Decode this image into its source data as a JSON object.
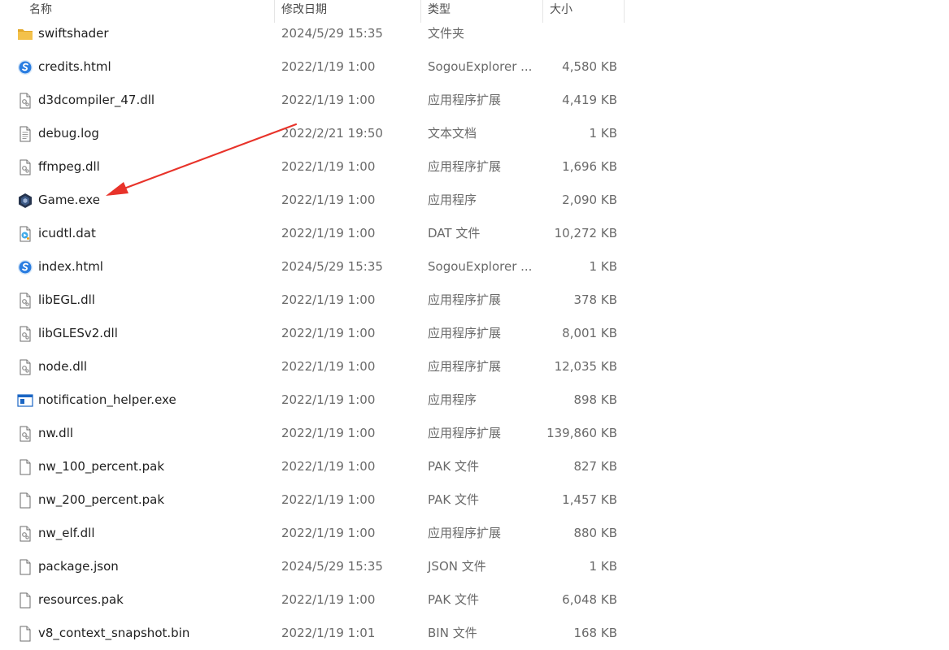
{
  "columns": {
    "name": "名称",
    "modified": "修改日期",
    "type": "类型",
    "size": "大小"
  },
  "colors": {
    "annotation_arrow": "#e8332a",
    "folder": "#f3c14b"
  },
  "files": [
    {
      "name": "swiftshader",
      "modified": "2024/5/29 15:35",
      "type": "文件夹",
      "size": "",
      "icon": "folder-icon"
    },
    {
      "name": "credits.html",
      "modified": "2022/1/19 1:00",
      "type": "SogouExplorer ...",
      "size": "4,580 KB",
      "icon": "browser-icon"
    },
    {
      "name": "d3dcompiler_47.dll",
      "modified": "2022/1/19 1:00",
      "type": "应用程序扩展",
      "size": "4,419 KB",
      "icon": "dll-icon"
    },
    {
      "name": "debug.log",
      "modified": "2022/2/21 19:50",
      "type": "文本文档",
      "size": "1 KB",
      "icon": "text-file-icon"
    },
    {
      "name": "ffmpeg.dll",
      "modified": "2022/1/19 1:00",
      "type": "应用程序扩展",
      "size": "1,696 KB",
      "icon": "dll-icon"
    },
    {
      "name": "Game.exe",
      "modified": "2022/1/19 1:00",
      "type": "应用程序",
      "size": "2,090 KB",
      "icon": "game-exe-icon"
    },
    {
      "name": "icudtl.dat",
      "modified": "2022/1/19 1:00",
      "type": "DAT 文件",
      "size": "10,272 KB",
      "icon": "media-file-icon"
    },
    {
      "name": "index.html",
      "modified": "2024/5/29 15:35",
      "type": "SogouExplorer ...",
      "size": "1 KB",
      "icon": "browser-icon"
    },
    {
      "name": "libEGL.dll",
      "modified": "2022/1/19 1:00",
      "type": "应用程序扩展",
      "size": "378 KB",
      "icon": "dll-icon"
    },
    {
      "name": "libGLESv2.dll",
      "modified": "2022/1/19 1:00",
      "type": "应用程序扩展",
      "size": "8,001 KB",
      "icon": "dll-icon"
    },
    {
      "name": "node.dll",
      "modified": "2022/1/19 1:00",
      "type": "应用程序扩展",
      "size": "12,035 KB",
      "icon": "dll-icon"
    },
    {
      "name": "notification_helper.exe",
      "modified": "2022/1/19 1:00",
      "type": "应用程序",
      "size": "898 KB",
      "icon": "exe-window-icon"
    },
    {
      "name": "nw.dll",
      "modified": "2022/1/19 1:00",
      "type": "应用程序扩展",
      "size": "139,860 KB",
      "icon": "dll-icon"
    },
    {
      "name": "nw_100_percent.pak",
      "modified": "2022/1/19 1:00",
      "type": "PAK 文件",
      "size": "827 KB",
      "icon": "blank-file-icon"
    },
    {
      "name": "nw_200_percent.pak",
      "modified": "2022/1/19 1:00",
      "type": "PAK 文件",
      "size": "1,457 KB",
      "icon": "blank-file-icon"
    },
    {
      "name": "nw_elf.dll",
      "modified": "2022/1/19 1:00",
      "type": "应用程序扩展",
      "size": "880 KB",
      "icon": "dll-icon"
    },
    {
      "name": "package.json",
      "modified": "2024/5/29 15:35",
      "type": "JSON 文件",
      "size": "1 KB",
      "icon": "blank-file-icon"
    },
    {
      "name": "resources.pak",
      "modified": "2022/1/19 1:00",
      "type": "PAK 文件",
      "size": "6,048 KB",
      "icon": "blank-file-icon"
    },
    {
      "name": "v8_context_snapshot.bin",
      "modified": "2022/1/19 1:01",
      "type": "BIN 文件",
      "size": "168 KB",
      "icon": "blank-file-icon"
    }
  ]
}
